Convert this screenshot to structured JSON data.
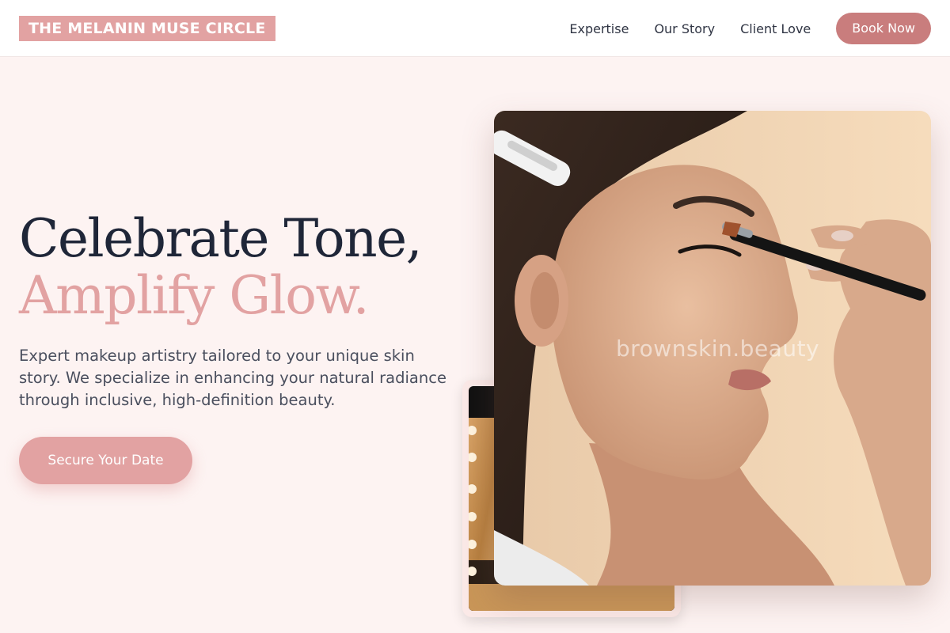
{
  "brand": {
    "name": "THE MELANIN MUSE CIRCLE"
  },
  "nav": {
    "links": [
      "Expertise",
      "Our Story",
      "Client Love"
    ],
    "book_label": "Book Now"
  },
  "hero": {
    "headline_line1": "Celebrate Tone,",
    "headline_line2": "Amplify Glow.",
    "description": "Expert makeup artistry tailored to your unique skin story. We specialize in enhancing your natural radiance through inclusive, high-definition beauty.",
    "cta_label": "Secure Your Date"
  },
  "images": {
    "main_photo": "makeup-artist-applying-eyeshadow",
    "secondary_photo": "vanity-mirror-with-lights",
    "watermark": "brownskin.beauty"
  },
  "colors": {
    "accent": "#e2a2a2",
    "button_dark": "#c97d7d",
    "heading": "#1f2638",
    "background": "#fdf3f2"
  }
}
